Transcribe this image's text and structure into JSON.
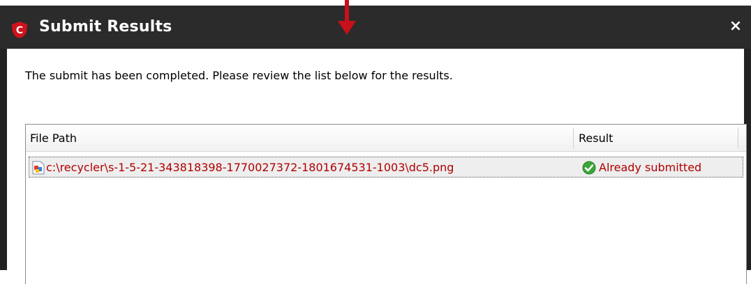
{
  "window": {
    "title": "Submit Results",
    "close_glyph": "×"
  },
  "message": "The submit has been completed. Please review the list below for the results.",
  "table": {
    "columns": [
      "File Path",
      "Result"
    ],
    "rows": [
      {
        "file_path": "c:\\recycler\\s-1-5-21-343818398-1770027372-1801674531-1003\\dc5.png",
        "result": "Already submitted",
        "file_icon": "image-file-icon",
        "result_icon": "green-check-icon"
      }
    ]
  },
  "colors": {
    "titlebar": "#2b2b2b",
    "brand_red": "#d0121b",
    "row_text": "#b00000",
    "pointer_arrow": "#c8101a"
  }
}
